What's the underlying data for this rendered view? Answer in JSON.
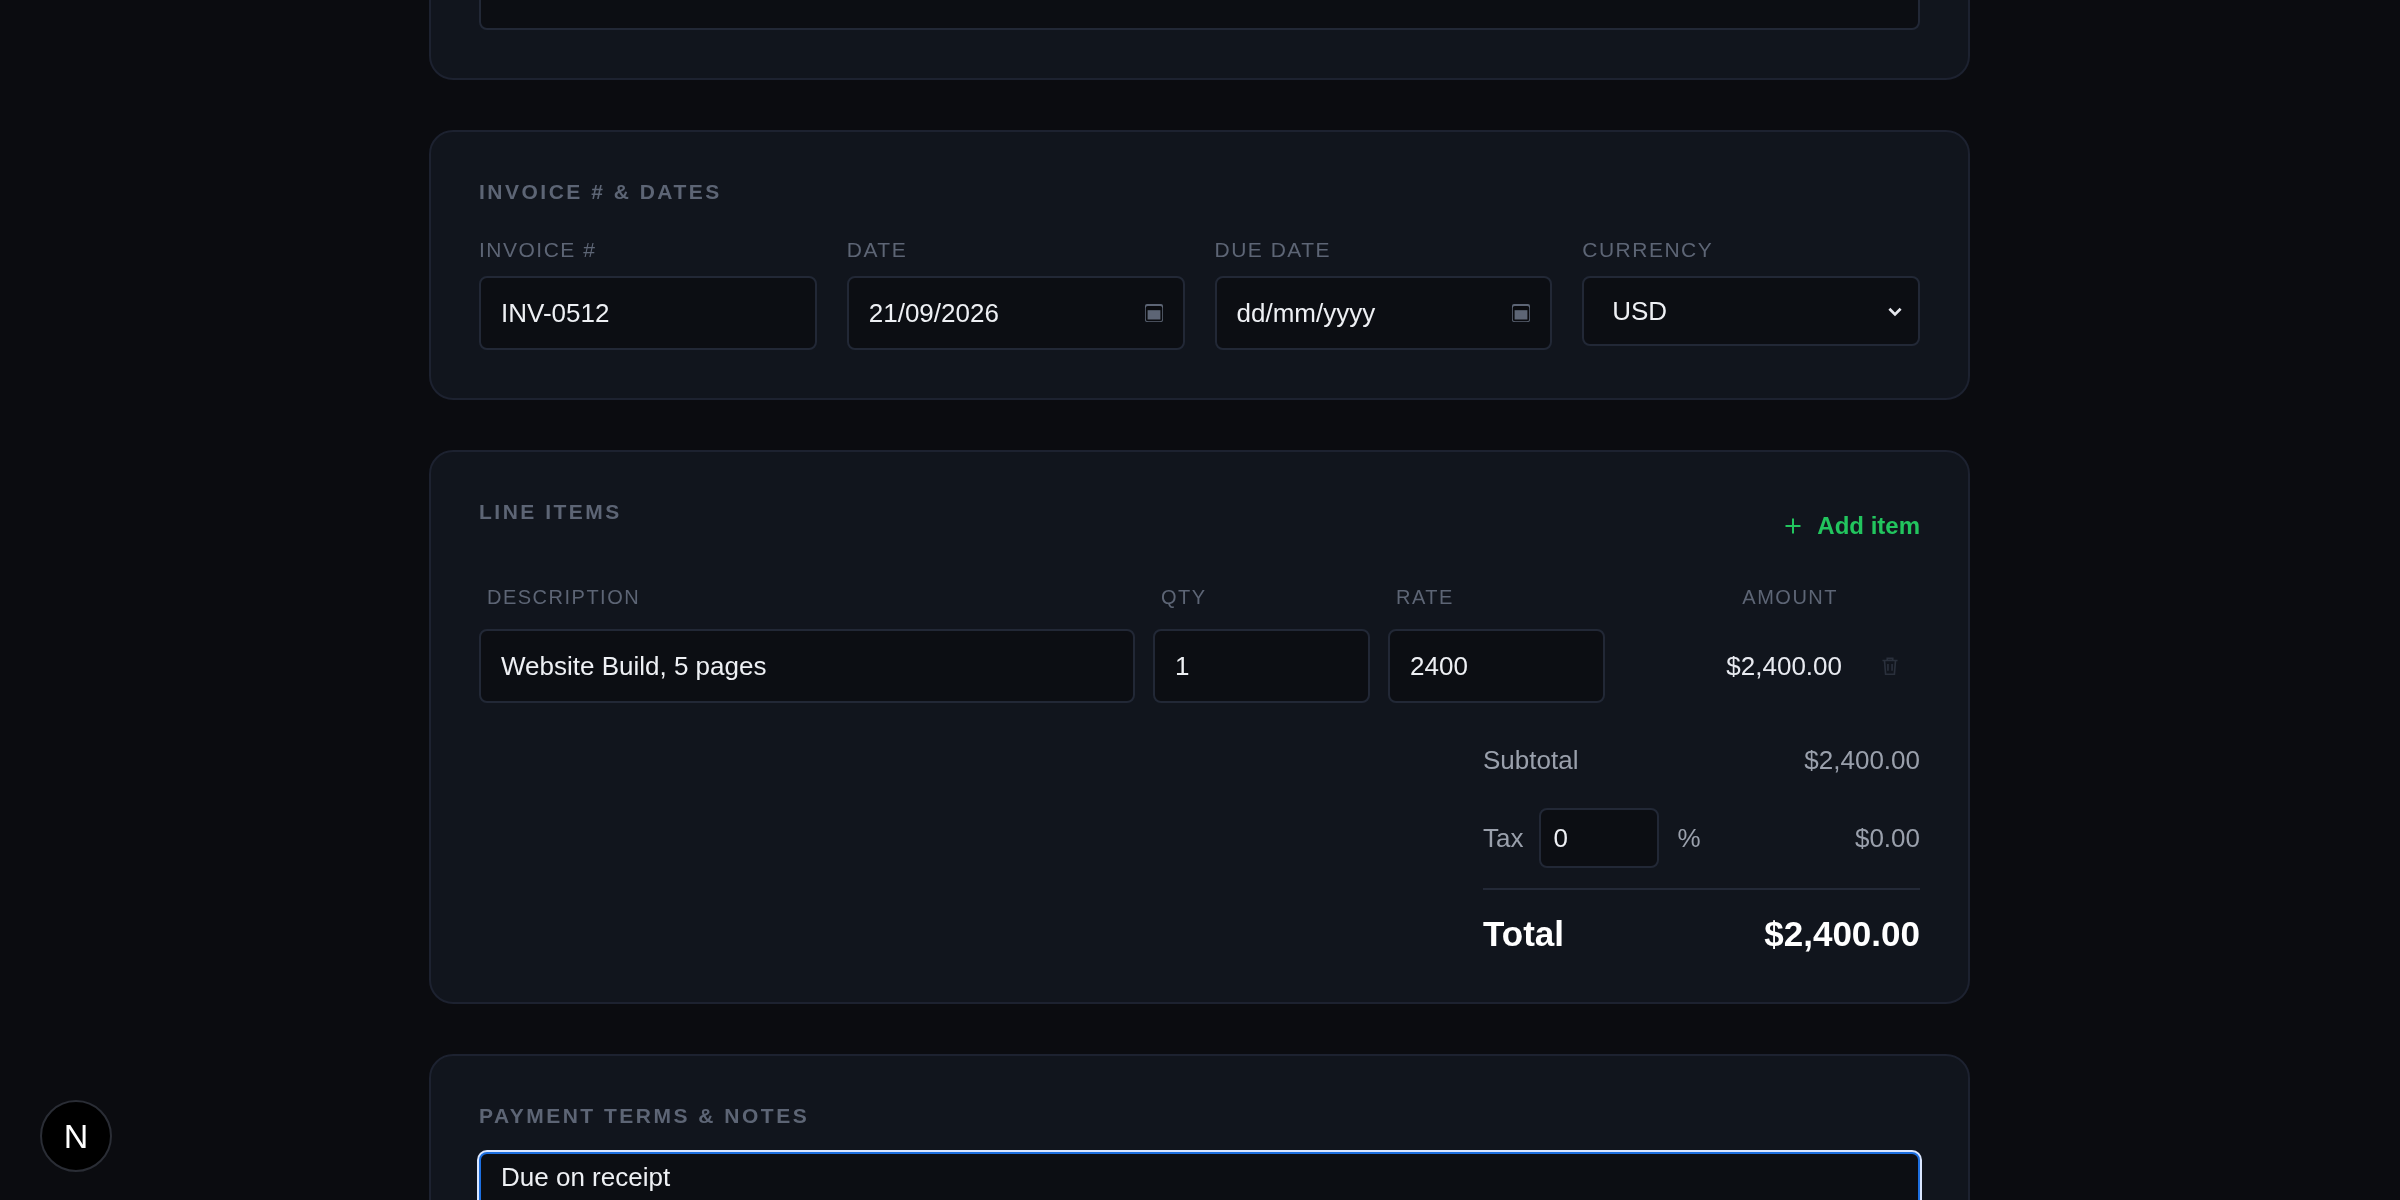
{
  "invoice_card": {
    "title": "INVOICE # & DATES",
    "fields": [
      {
        "kind": "text",
        "label": "INVOICE #",
        "value": "INV-0512"
      },
      {
        "kind": "date",
        "label": "DATE",
        "value": "21/09/2026"
      },
      {
        "kind": "date",
        "label": "DUE DATE",
        "placeholder": "dd/mm/yyyy"
      },
      {
        "kind": "select",
        "label": "CURRENCY",
        "value": "USD"
      }
    ]
  },
  "line_items": {
    "title": "LINE ITEMS",
    "add_button": "Add item",
    "columns": [
      "DESCRIPTION",
      "QTY",
      "RATE",
      "AMOUNT"
    ],
    "rows": [
      {
        "description": "Website Build, 5 pages",
        "qty": "1",
        "rate": "2400",
        "amount": "$2,400.00"
      }
    ],
    "subtotal": {
      "label": "Subtotal",
      "value": "$2,400.00"
    },
    "tax": {
      "label": "Tax",
      "rate": "0",
      "unit": "%",
      "value": "$0.00"
    },
    "total": {
      "label": "Total",
      "value": "$2,400.00"
    }
  },
  "payment_card": {
    "title": "PAYMENT TERMS & NOTES",
    "terms": {
      "value": "Due on receipt",
      "focused": true
    }
  },
  "badge": {
    "letter": "N"
  }
}
